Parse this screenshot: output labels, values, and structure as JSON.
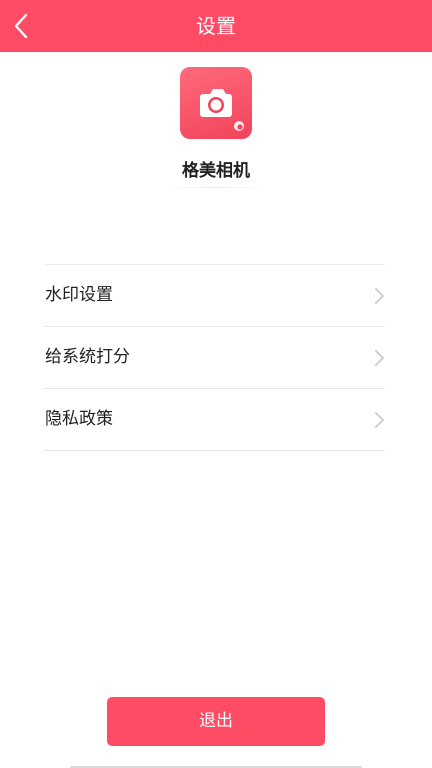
{
  "header": {
    "title": "设置",
    "back_icon": "chevron-left-icon",
    "background_color": "#ff4b63"
  },
  "app": {
    "name": "格美相机",
    "icon": "camera-icon",
    "icon_color": "#f2435a"
  },
  "menu": {
    "items": [
      {
        "label": "水印设置",
        "icon": "chevron-right-icon"
      },
      {
        "label": "给系统打分",
        "icon": "chevron-right-icon"
      },
      {
        "label": "隐私政策",
        "icon": "chevron-right-icon"
      }
    ]
  },
  "footer": {
    "logout_label": "退出",
    "button_color": "#ff4b63"
  }
}
